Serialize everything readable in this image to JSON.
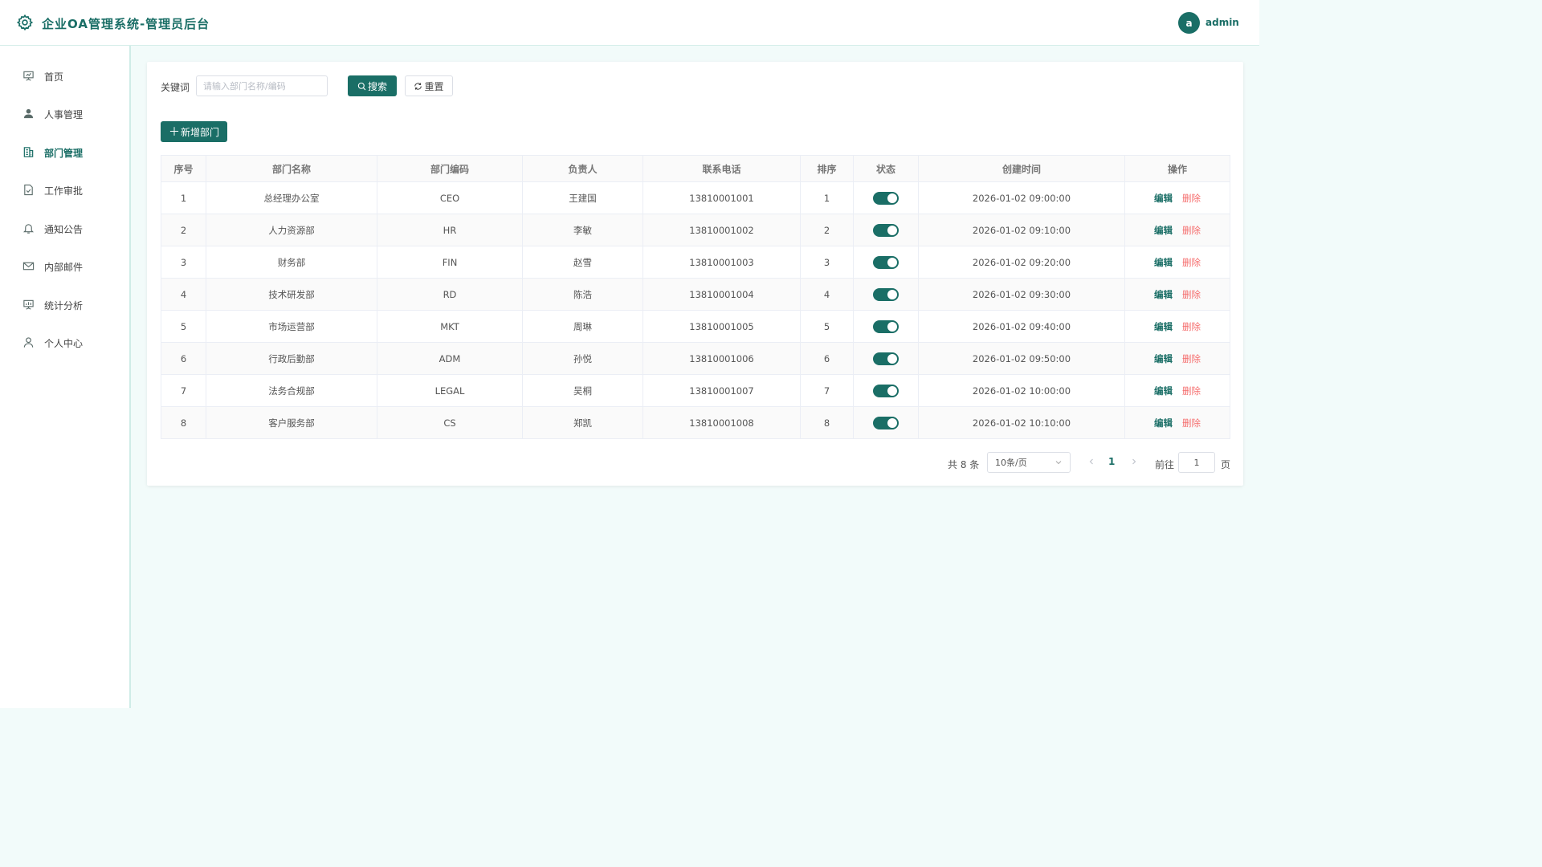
{
  "header": {
    "title": "企业OA管理系统-管理员后台",
    "avatar_letter": "a",
    "username": "admin"
  },
  "sidebar": {
    "items": [
      {
        "label": "首页",
        "icon": "presentation-icon"
      },
      {
        "label": "人事管理",
        "icon": "user-filled-icon"
      },
      {
        "label": "部门管理",
        "icon": "building-icon",
        "active": true
      },
      {
        "label": "工作审批",
        "icon": "document-check-icon"
      },
      {
        "label": "通知公告",
        "icon": "bell-icon"
      },
      {
        "label": "内部邮件",
        "icon": "mail-icon"
      },
      {
        "label": "统计分析",
        "icon": "chart-board-icon"
      },
      {
        "label": "个人中心",
        "icon": "user-outline-icon"
      }
    ]
  },
  "search": {
    "label": "关键词",
    "placeholder": "请输入部门名称/编码",
    "value": "",
    "search_button": "搜索",
    "reset_button": "重置"
  },
  "toolbar": {
    "add_button": "新增部门"
  },
  "table": {
    "columns": [
      "序号",
      "部门名称",
      "部门编码",
      "负责人",
      "联系电话",
      "排序",
      "状态",
      "创建时间",
      "操作"
    ],
    "rows": [
      {
        "no": "1",
        "name": "总经理办公室",
        "code": "CEO",
        "leader": "王建国",
        "phone": "13810001001",
        "sort": "1",
        "status": true,
        "created": "2026-01-02 09:00:00"
      },
      {
        "no": "2",
        "name": "人力资源部",
        "code": "HR",
        "leader": "李敏",
        "phone": "13810001002",
        "sort": "2",
        "status": true,
        "created": "2026-01-02 09:10:00"
      },
      {
        "no": "3",
        "name": "财务部",
        "code": "FIN",
        "leader": "赵雪",
        "phone": "13810001003",
        "sort": "3",
        "status": true,
        "created": "2026-01-02 09:20:00"
      },
      {
        "no": "4",
        "name": "技术研发部",
        "code": "RD",
        "leader": "陈浩",
        "phone": "13810001004",
        "sort": "4",
        "status": true,
        "created": "2026-01-02 09:30:00"
      },
      {
        "no": "5",
        "name": "市场运营部",
        "code": "MKT",
        "leader": "周琳",
        "phone": "13810001005",
        "sort": "5",
        "status": true,
        "created": "2026-01-02 09:40:00"
      },
      {
        "no": "6",
        "name": "行政后勤部",
        "code": "ADM",
        "leader": "孙悦",
        "phone": "13810001006",
        "sort": "6",
        "status": true,
        "created": "2026-01-02 09:50:00"
      },
      {
        "no": "7",
        "name": "法务合规部",
        "code": "LEGAL",
        "leader": "吴桐",
        "phone": "13810001007",
        "sort": "7",
        "status": true,
        "created": "2026-01-02 10:00:00"
      },
      {
        "no": "8",
        "name": "客户服务部",
        "code": "CS",
        "leader": "郑凯",
        "phone": "13810001008",
        "sort": "8",
        "status": true,
        "created": "2026-01-02 10:10:00"
      }
    ],
    "edit_label": "编辑",
    "delete_label": "删除"
  },
  "pagination": {
    "total_text": "共 8 条",
    "page_size": "10条/页",
    "current_page": "1",
    "goto_label": "前往",
    "goto_value": "1",
    "page_suffix": "页"
  },
  "colors": {
    "primary": "#1a6e66",
    "danger": "#f56c6c",
    "background": "#f2fbfa"
  }
}
